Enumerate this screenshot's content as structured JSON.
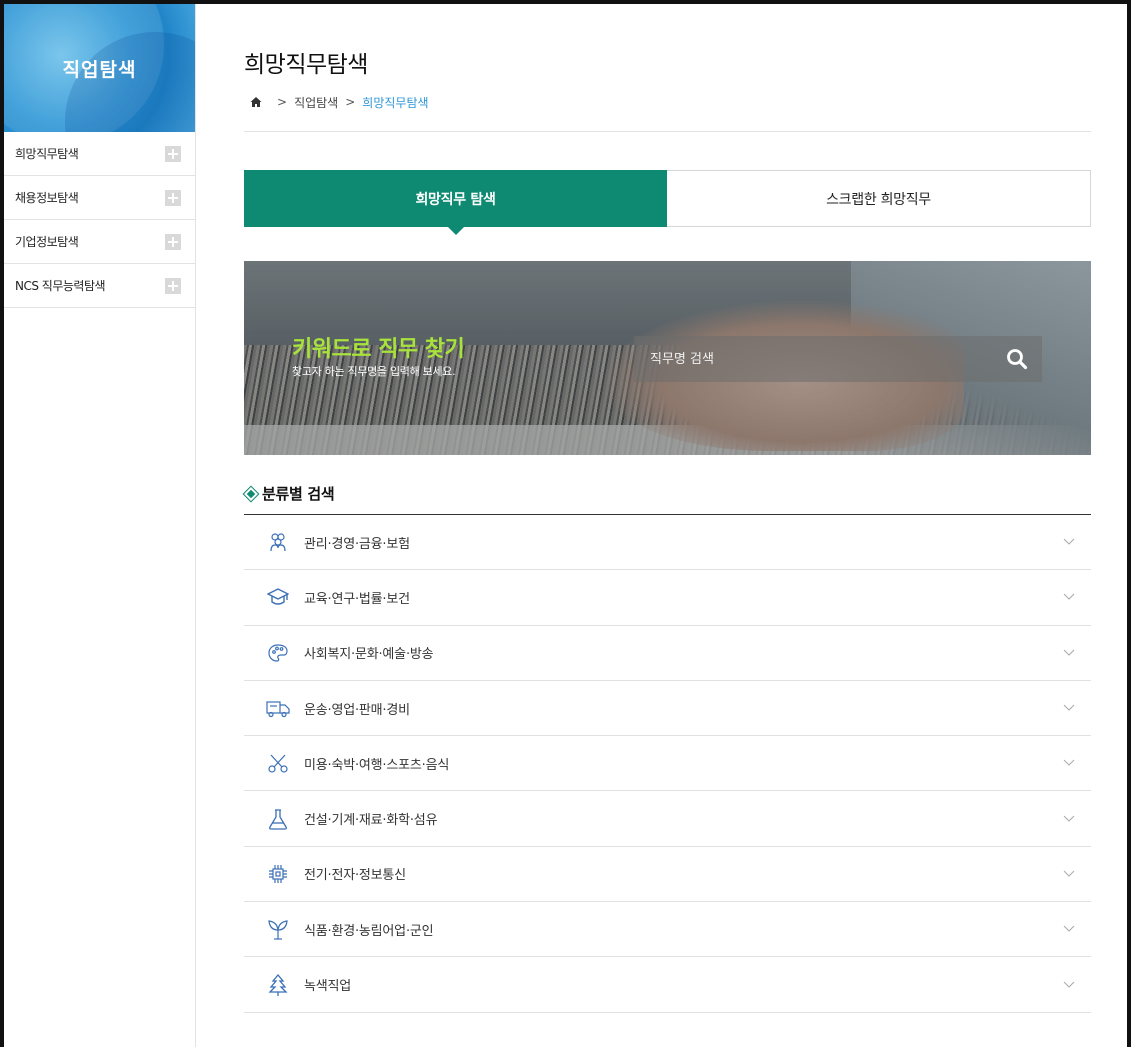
{
  "sidebar": {
    "title": "직업탐색",
    "items": [
      {
        "label": "희망직무탐색"
      },
      {
        "label": "채용정보탐색"
      },
      {
        "label": "기업정보탐색"
      },
      {
        "label": "NCS 직무능력탐색"
      }
    ]
  },
  "header": {
    "title": "희망직무탐색",
    "breadcrumb": {
      "home_icon": "home-icon",
      "sep": ">",
      "level1": "직업탐색",
      "current": "희망직무탐색"
    }
  },
  "tabs": [
    {
      "label": "희망직무 탐색",
      "active": true
    },
    {
      "label": "스크랩한 희망직무",
      "active": false
    }
  ],
  "banner": {
    "title": "키워드로 직무 찾기",
    "subtitle": "찾고자 하는 직무명을 입력해 보세요.",
    "search_placeholder": "직무명 검색",
    "search_icon": "search-icon"
  },
  "categories": {
    "section_title": "분류별 검색",
    "items": [
      {
        "label": "관리·경영·금융·보험",
        "icon": "people-icon"
      },
      {
        "label": "교육·연구·법률·보건",
        "icon": "graduation-cap-icon"
      },
      {
        "label": "사회복지·문화·예술·방송",
        "icon": "palette-icon"
      },
      {
        "label": "운송·영업·판매·경비",
        "icon": "truck-icon"
      },
      {
        "label": "미용·숙박·여행·스포츠·음식",
        "icon": "scissors-icon"
      },
      {
        "label": "건설·기계·재료·화학·섬유",
        "icon": "flask-icon"
      },
      {
        "label": "전기·전자·정보통신",
        "icon": "chip-icon"
      },
      {
        "label": "식품·환경·농림어업·군인",
        "icon": "plant-icon"
      },
      {
        "label": "녹색직업",
        "icon": "tree-icon"
      }
    ]
  },
  "colors": {
    "accent_green": "#0f8a72",
    "accent_blue": "#2f97d6",
    "banner_title": "#a7e33a",
    "icon_blue": "#3b6fb6"
  }
}
